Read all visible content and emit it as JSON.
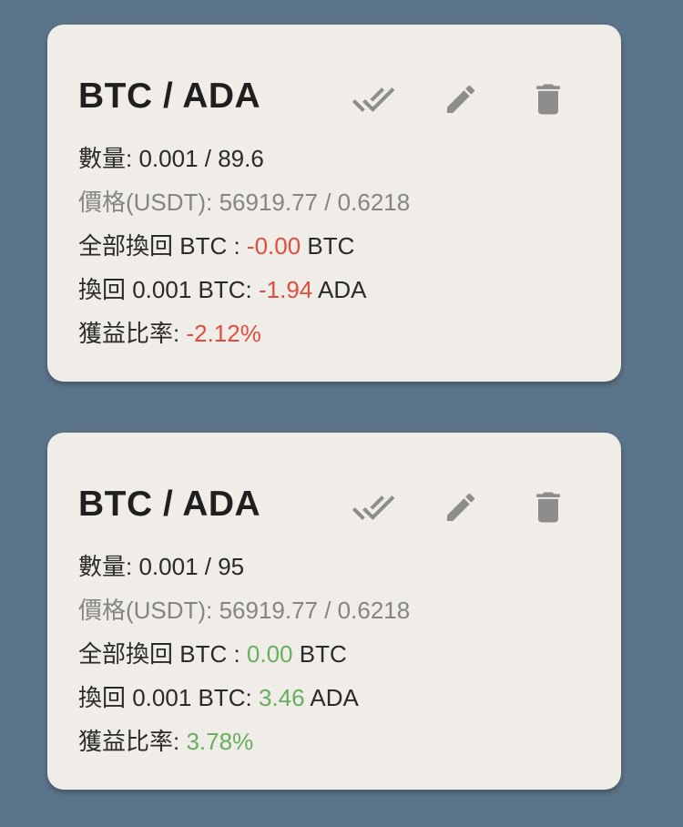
{
  "colors": {
    "background": "#5b7489",
    "card": "#f0ece7",
    "negative": "#e04e3f",
    "positive": "#66b05e",
    "icon": "#8d8d8d"
  },
  "icons": [
    "check-all-icon",
    "pencil-icon",
    "trash-icon"
  ],
  "cards": [
    {
      "title": "BTC / ADA",
      "quantity_label": "數量:",
      "quantity_value": "0.001 / 89.6",
      "price_label": "價格(USDT):",
      "price_value": "56919.77 / 0.6218",
      "redeem_all_label": "全部換回 BTC :",
      "redeem_all_value": "-0.00",
      "redeem_all_unit": "BTC",
      "redeem_label": "換回 0.001 BTC:",
      "redeem_value": "-1.94",
      "redeem_unit": "ADA",
      "ratio_label": "獲益比率:",
      "ratio_value": "-2.12%"
    },
    {
      "title": "BTC / ADA",
      "quantity_label": "數量:",
      "quantity_value": "0.001 / 95",
      "price_label": "價格(USDT):",
      "price_value": "56919.77 / 0.6218",
      "redeem_all_label": "全部換回 BTC :",
      "redeem_all_value": "0.00",
      "redeem_all_unit": "BTC",
      "redeem_label": "換回 0.001 BTC:",
      "redeem_value": "3.46",
      "redeem_unit": "ADA",
      "ratio_label": "獲益比率:",
      "ratio_value": "3.78%"
    }
  ]
}
